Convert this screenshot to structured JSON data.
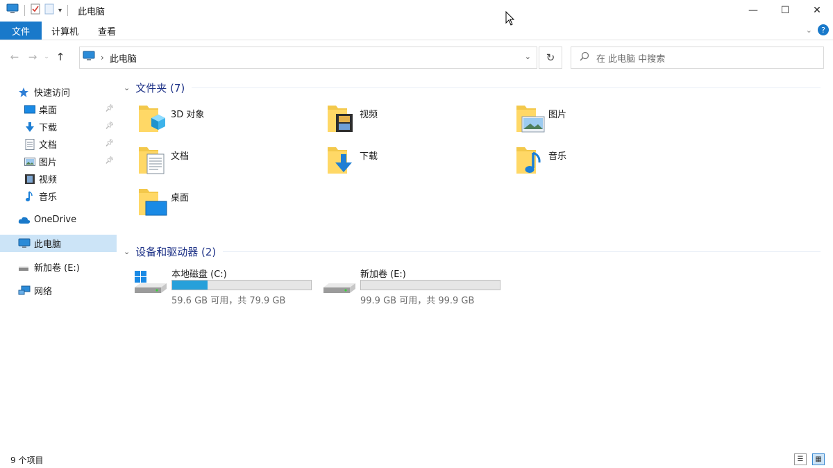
{
  "window": {
    "title": "此电脑",
    "controls": [
      "minimize",
      "maximize",
      "close"
    ]
  },
  "ribbon": {
    "tabs": [
      "文件",
      "计算机",
      "查看"
    ],
    "help_label": "?"
  },
  "navigation": {
    "breadcrumb": "此电脑",
    "search_placeholder": "在 此电脑 中搜索"
  },
  "sidebar": {
    "quick_access": "快速访问",
    "pinned": [
      "桌面",
      "下载",
      "文档",
      "图片"
    ],
    "unpinned": [
      "视频",
      "音乐"
    ],
    "onedrive": "OneDrive",
    "this_pc": "此电脑",
    "new_volume": "新加卷 (E:)",
    "network": "网络"
  },
  "content": {
    "folders_header": "文件夹 (7)",
    "folders": [
      {
        "name": "3D 对象",
        "icon": "3d-objects-folder-icon"
      },
      {
        "name": "视频",
        "icon": "videos-folder-icon"
      },
      {
        "name": "图片",
        "icon": "pictures-folder-icon"
      },
      {
        "name": "文档",
        "icon": "documents-folder-icon"
      },
      {
        "name": "下载",
        "icon": "downloads-folder-icon"
      },
      {
        "name": "音乐",
        "icon": "music-folder-icon"
      },
      {
        "name": "桌面",
        "icon": "desktop-folder-icon"
      }
    ],
    "drives_header": "设备和驱动器 (2)",
    "drives": [
      {
        "name": "本地磁盘 (C:)",
        "free": "59.6 GB 可用，共 79.9 GB",
        "used_fraction": 0.254,
        "icon": "windows-drive-icon"
      },
      {
        "name": "新加卷 (E:)",
        "free": "99.9 GB 可用，共 99.9 GB",
        "used_fraction": 0.0,
        "icon": "drive-icon"
      }
    ]
  },
  "status": {
    "item_count": "9 个项目"
  },
  "colors": {
    "accent": "#1979ca",
    "selection": "#cce4f7",
    "drive_fill": "#26a0da",
    "group_header": "#1e3287"
  }
}
